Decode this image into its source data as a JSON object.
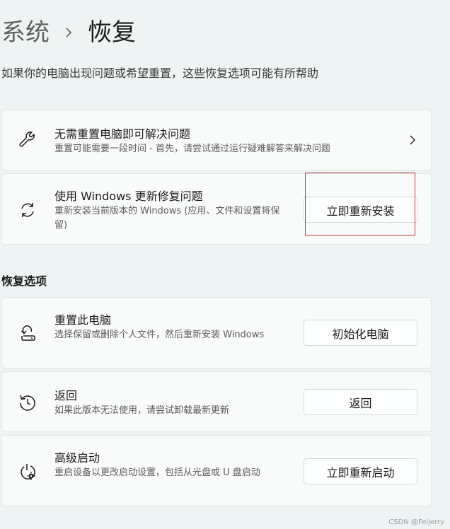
{
  "breadcrumb": {
    "parent": "系统",
    "current": "恢复"
  },
  "subtitle": "如果你的电脑出现问题或希望重置，这些恢复选项可能有所帮助",
  "troubleshoot": {
    "title": "无需重置电脑即可解决问题",
    "description": "重置可能需要一段时间 - 首先，请尝试通过运行疑难解答来解决问题",
    "icon": "wrench-icon"
  },
  "windows_update": {
    "title": "使用 Windows 更新修复问题",
    "description": "重新安装当前版本的 Windows (应用、文件和设置将保留)",
    "button": "立即重新安装",
    "icon": "sync-icon"
  },
  "recovery_options": {
    "heading": "恢复选项",
    "items": [
      {
        "title": "重置此电脑",
        "description": "选择保留或删除个人文件，然后重新安装 Windows",
        "button": "初始化电脑",
        "icon": "reset-pc-icon"
      },
      {
        "title": "返回",
        "description": "如果此版本无法使用，请尝试卸载最新更新",
        "button": "返回",
        "icon": "history-icon"
      },
      {
        "title": "高级启动",
        "description": "重启设备以更改启动设置，包括从光盘或 U 盘启动",
        "button": "立即重新启动",
        "icon": "advanced-startup-icon"
      }
    ]
  },
  "watermark": "CSDN @Feijerry"
}
